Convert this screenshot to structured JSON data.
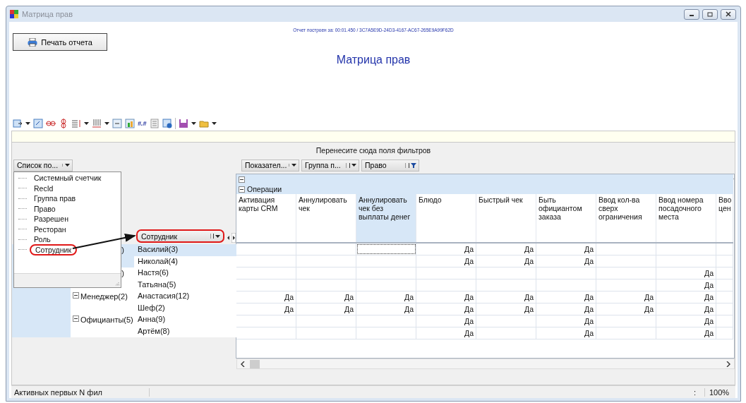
{
  "window": {
    "title": "Матрица прав"
  },
  "report": {
    "info": "Отчет построен за: 00:01.450 / 3C7A5E9D-24D3-4167-AC67-265E9A99F62D",
    "print_button": "Печать отчета",
    "title": "Матрица прав"
  },
  "toolbar": {
    "format_label": "#.#"
  },
  "filter_hint": "Перенесите сюда поля фильтров",
  "field_list_button": "Список по...",
  "column_fields": [
    {
      "label": "Показател...",
      "kind": "dropdown"
    },
    {
      "label": "Группа п...",
      "kind": "sort"
    },
    {
      "label": "Право",
      "kind": "filter"
    }
  ],
  "row_field": {
    "label": "Сотрудник",
    "highlighted": true
  },
  "field_list": [
    {
      "label": "Системный счетчик",
      "highlighted": false
    },
    {
      "label": "RecId",
      "highlighted": false
    },
    {
      "label": "Группа прав",
      "highlighted": false
    },
    {
      "label": "Право",
      "highlighted": false
    },
    {
      "label": "Разрешен",
      "highlighted": false
    },
    {
      "label": "Ресторан",
      "highlighted": false
    },
    {
      "label": "Роль",
      "highlighted": false
    },
    {
      "label": "Сотрудник",
      "highlighted": true
    }
  ],
  "column_group": "Операции",
  "columns": [
    {
      "label": "Активация карты CRM",
      "selected": false
    },
    {
      "label": "Аннулировать чек",
      "selected": false
    },
    {
      "label": "Аннулировать чек без выплаты денег",
      "selected": true
    },
    {
      "label": "Блюдо",
      "selected": false
    },
    {
      "label": "Быстрый чек",
      "selected": false
    },
    {
      "label": "Быть официантом заказа",
      "selected": false
    },
    {
      "label": "Ввод кол-ва сверх ограничения",
      "selected": false
    },
    {
      "label": "Ввод номера посадочного места",
      "selected": false
    },
    {
      "label": "Вво цен",
      "selected": false
    }
  ],
  "groups": [
    {
      "label": ")",
      "kind": "covered",
      "selected": true,
      "employees": [
        {
          "name": "Василий(3)",
          "selected": true,
          "cells": [
            {
              "focused": false
            },
            {
              "focused": false
            },
            {
              "focused": true
            },
            {
              "text": "Да",
              "focused": false
            },
            {
              "text": "Да",
              "focused": false
            },
            {
              "text": "Да",
              "focused": false
            },
            {
              "focused": false
            },
            {
              "focused": false
            },
            {
              "focused": false
            }
          ]
        },
        {
          "name": "Николай(4)",
          "selected": false,
          "cells": [
            {
              "focused": false
            },
            {
              "focused": false
            },
            {
              "focused": false
            },
            {
              "text": "Да",
              "focused": false
            },
            {
              "text": "Да",
              "focused": false
            },
            {
              "text": "Да",
              "focused": false
            },
            {
              "focused": false
            },
            {
              "focused": false
            },
            {
              "focused": false
            }
          ]
        }
      ]
    },
    {
      "label": ")",
      "kind": "covered",
      "selected": false,
      "employees": [
        {
          "name": "Настя(6)",
          "selected": false,
          "cells": [
            {
              "focused": false
            },
            {
              "focused": false
            },
            {
              "focused": false
            },
            {
              "focused": false
            },
            {
              "focused": false
            },
            {
              "focused": false
            },
            {
              "focused": false
            },
            {
              "text": "Да",
              "focused": false
            },
            {
              "focused": false
            }
          ]
        },
        {
          "name": "Татьяна(5)",
          "selected": false,
          "cells": [
            {
              "focused": false
            },
            {
              "focused": false
            },
            {
              "focused": false
            },
            {
              "focused": false
            },
            {
              "focused": false
            },
            {
              "focused": false
            },
            {
              "focused": false
            },
            {
              "text": "Да",
              "focused": false
            },
            {
              "focused": false
            }
          ]
        }
      ]
    },
    {
      "label": "Менеджер(2)",
      "kind": "expandable",
      "selected": false,
      "employees": [
        {
          "name": "Анастасия(12)",
          "selected": false,
          "cells": [
            {
              "text": "Да",
              "focused": false
            },
            {
              "text": "Да",
              "focused": false
            },
            {
              "text": "Да",
              "focused": false
            },
            {
              "text": "Да",
              "focused": false
            },
            {
              "text": "Да",
              "focused": false
            },
            {
              "text": "Да",
              "focused": false
            },
            {
              "text": "Да",
              "focused": false
            },
            {
              "text": "Да",
              "focused": false
            },
            {
              "focused": false
            }
          ]
        },
        {
          "name": "Шеф(2)",
          "selected": false,
          "cells": [
            {
              "text": "Да",
              "focused": false
            },
            {
              "text": "Да",
              "focused": false
            },
            {
              "text": "Да",
              "focused": false
            },
            {
              "text": "Да",
              "focused": false
            },
            {
              "text": "Да",
              "focused": false
            },
            {
              "text": "Да",
              "focused": false
            },
            {
              "text": "Да",
              "focused": false
            },
            {
              "text": "Да",
              "focused": false
            },
            {
              "focused": false
            }
          ]
        }
      ]
    },
    {
      "label": "Официанты(5)",
      "kind": "expandable",
      "selected": false,
      "employees": [
        {
          "name": "Анна(9)",
          "selected": false,
          "cells": [
            {
              "focused": false
            },
            {
              "focused": false
            },
            {
              "focused": false
            },
            {
              "text": "Да",
              "focused": false
            },
            {
              "focused": false
            },
            {
              "text": "Да",
              "focused": false
            },
            {
              "focused": false
            },
            {
              "text": "Да",
              "focused": false
            },
            {
              "focused": false
            }
          ]
        },
        {
          "name": "Артём(8)",
          "selected": false,
          "cells": [
            {
              "focused": false
            },
            {
              "focused": false
            },
            {
              "focused": false
            },
            {
              "text": "Да",
              "focused": false
            },
            {
              "focused": false
            },
            {
              "text": "Да",
              "focused": false
            },
            {
              "focused": false
            },
            {
              "text": "Да",
              "focused": false
            },
            {
              "focused": false
            }
          ]
        }
      ]
    }
  ],
  "status": {
    "text": "Активных первых N фил",
    "separator": ":",
    "zoom": "100%"
  }
}
